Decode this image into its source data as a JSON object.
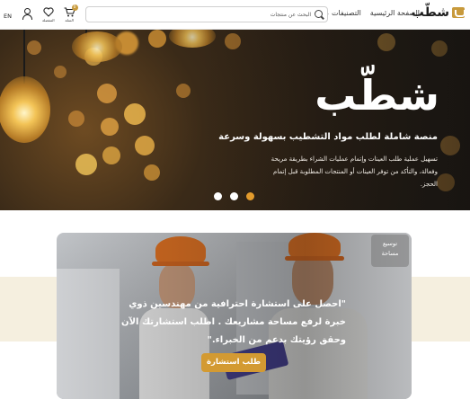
{
  "header": {
    "logo_text": "شطّب",
    "nav": {
      "home": "الصفحة الرئيسية",
      "categories": "التصنيفات"
    },
    "search": {
      "placeholder": "البحث عن منتجات"
    },
    "language": "EN",
    "wishlist_label": "المفضلة",
    "cart_label": "السلة",
    "cart_count": "0"
  },
  "hero": {
    "title": "شطّب",
    "subtitle": "منصة شاملة لطلب مواد التشطيب بسهولة وسرعة",
    "description": "تسهيل عملية طلب العينات وإتمام عمليات الشراء بطريقة مريحة وفعالة، والتأكد من توفر العينات أو المنتجات المطلوبة قبل إتمام الحجز.",
    "slides": 3,
    "active_slide": 3
  },
  "consultation": {
    "badge_line1": "توسيع",
    "badge_line2": "مساحة",
    "quote": "\"احصل على استشارة احترافية من مهندسين ذوي خبرة لرفع مساحة مشاريعك . اطلب استشارتك الآن وحقق رؤيتك بدعم من الخبراء.\"",
    "cta_label": "طلب استشارة"
  },
  "colors": {
    "accent": "#d39a32",
    "dot_active": "#e39b2c",
    "band": "#f5efdf"
  },
  "icons": [
    "search-icon",
    "user-icon",
    "heart-icon",
    "cart-icon",
    "chevron-down-icon"
  ]
}
